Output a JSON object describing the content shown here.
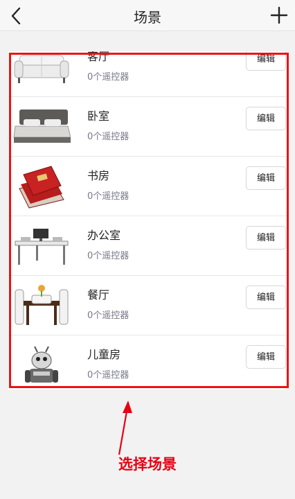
{
  "header": {
    "title": "场景",
    "back_icon": "chevron-left-icon",
    "add_icon": "plus-icon"
  },
  "scenes": [
    {
      "name": "客厅",
      "subtitle": "0个遥控器",
      "edit_label": "编辑",
      "icon": "sofa-icon"
    },
    {
      "name": "卧室",
      "subtitle": "0个遥控器",
      "edit_label": "编辑",
      "icon": "bed-icon"
    },
    {
      "name": "书房",
      "subtitle": "0个遥控器",
      "edit_label": "编辑",
      "icon": "books-icon"
    },
    {
      "name": "办公室",
      "subtitle": "0个遥控器",
      "edit_label": "编辑",
      "icon": "desk-icon"
    },
    {
      "name": "餐厅",
      "subtitle": "0个遥控器",
      "edit_label": "编辑",
      "icon": "dining-table-icon"
    },
    {
      "name": "儿童房",
      "subtitle": "0个遥控器",
      "edit_label": "编辑",
      "icon": "toy-robot-icon"
    }
  ],
  "annotation": {
    "caption": "选择场景",
    "color": "#e60012"
  }
}
